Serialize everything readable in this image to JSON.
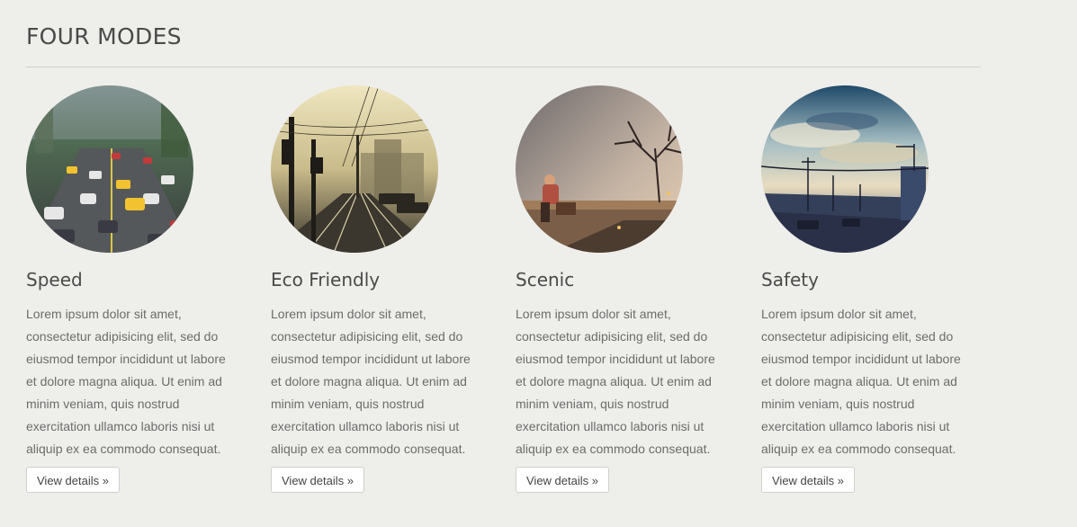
{
  "section": {
    "title": "FOUR MODES"
  },
  "modes": [
    {
      "title": "Speed",
      "image": "city-traffic-photo",
      "text": "Lorem ipsum dolor sit amet, consectetur adipisicing elit, sed do eiusmod tempor incididunt ut labore et dolore magna aliqua. Ut enim ad minim veniam, quis nostrud exercitation ullamco laboris nisi ut aliquip ex ea commodo consequat.",
      "button": "View details »"
    },
    {
      "title": "Eco Friendly",
      "image": "tram-tracks-photo",
      "text": "Lorem ipsum dolor sit amet, consectetur adipisicing elit, sed do eiusmod tempor incididunt ut labore et dolore magna aliqua. Ut enim ad minim veniam, quis nostrud exercitation ullamco laboris nisi ut aliquip ex ea commodo consequat.",
      "button": "View details »"
    },
    {
      "title": "Scenic",
      "image": "countryside-traveler-photo",
      "text": "Lorem ipsum dolor sit amet, consectetur adipisicing elit, sed do eiusmod tempor incididunt ut labore et dolore magna aliqua. Ut enim ad minim veniam, quis nostrud exercitation ullamco laboris nisi ut aliquip ex ea commodo consequat.",
      "button": "View details »"
    },
    {
      "title": "Safety",
      "image": "sky-bridge-photo",
      "text": "Lorem ipsum dolor sit amet, consectetur adipisicing elit, sed do eiusmod tempor incididunt ut labore et dolore magna aliqua. Ut enim ad minim veniam, quis nostrud exercitation ullamco laboris nisi ut aliquip ex ea commodo consequat.",
      "button": "View details »"
    }
  ],
  "colors": {
    "background": "#eeeeea",
    "heading": "#4a4a4a",
    "body_text": "#6c6c6c",
    "divider": "#d2d2cd",
    "button_bg": "#ffffff",
    "button_border": "#d0d0cc"
  }
}
